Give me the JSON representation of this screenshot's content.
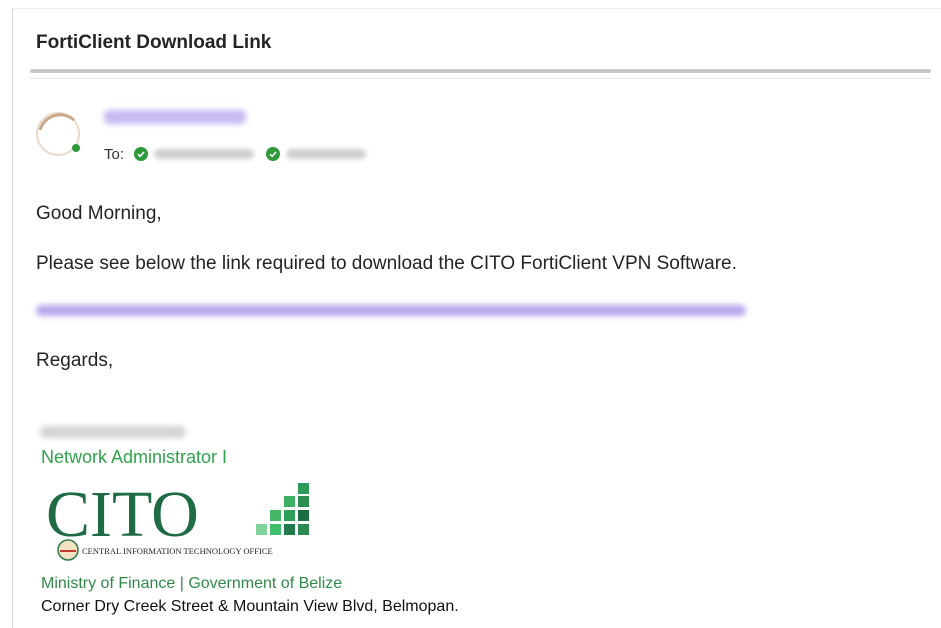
{
  "email": {
    "subject": "FortiClient Download Link",
    "to_label": "To:",
    "greeting": "Good Morning,",
    "body": "Please see below the link required to download the CITO FortiClient VPN Software.",
    "closing": "Regards,"
  },
  "signature": {
    "title": "Network Administrator I",
    "logo_text": "CITO",
    "logo_subtext": "CENTRAL INFORMATION TECHNOLOGY OFFICE",
    "ministry": "Ministry of Finance | Government of Belize",
    "address": "Corner Dry Creek Street & Mountain View Blvd, Belmopan."
  },
  "colors": {
    "accent_green": "#2ea34a",
    "logo_green": "#1f7a4f",
    "link_purple": "#b8a6ec",
    "status_green": "#2e9a3a"
  }
}
